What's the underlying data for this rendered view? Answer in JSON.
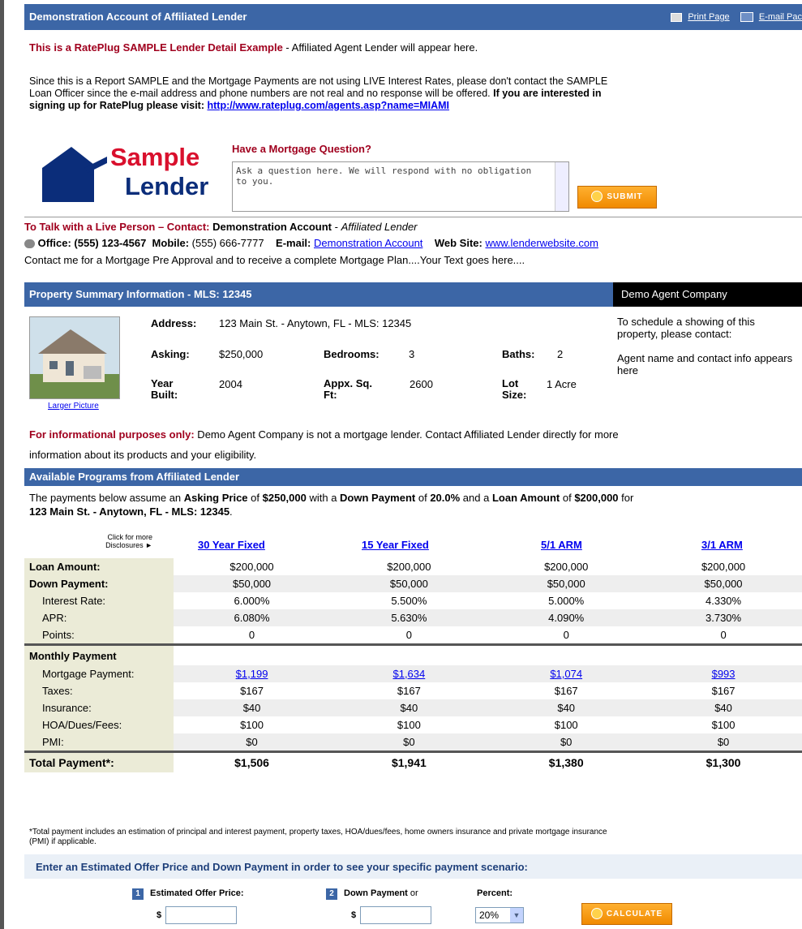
{
  "header": {
    "title": "Demonstration Account of Affiliated Lender",
    "print_label": "Print Page",
    "email_label": "E-mail Pac"
  },
  "intro": {
    "sample_bold": "This is a RatePlug SAMPLE Lender Detail Example",
    "sample_rest": " - Affiliated Agent Lender will appear here.",
    "note_line1": "Since this is a Report SAMPLE and the Mortgage Payments are not using LIVE Interest Rates, please don't contact the SAMPLE",
    "note_line2_a": "Loan Officer since the e-mail address and phone numbers are not real and no response will be offered. ",
    "note_line2_b": "If you are interested in",
    "note_line3": "signing up for RatePlug please visit: ",
    "signup_link": "http://www.rateplug.com/agents.asp?name=MIAMI"
  },
  "logo": {
    "word1": "Sample",
    "word2": "Lender"
  },
  "question": {
    "title": "Have a Mortgage Question?",
    "placeholder": "Ask a question here. We will respond with no obligation to you.",
    "submit_label": "SUBMIT"
  },
  "contact": {
    "lead": "To Talk with a Live Person – Contact:",
    "name": "Demonstration Account",
    "role": "Affiliated Lender",
    "office_label": "Office: (555) 123-4567",
    "mobile_label": "Mobile:",
    "mobile": "(555) 666-7777",
    "email_label": "E-mail:",
    "email_link": "Demonstration Account",
    "web_label": "Web Site:",
    "web_link": "www.lenderwebsite.com",
    "message": "Contact me for a Mortgage Pre Approval and to receive a complete Mortgage Plan....Your Text goes here...."
  },
  "property": {
    "bar_title": "Property Summary Information - MLS: 12345",
    "agent_company": "Demo Agent Company",
    "larger_picture": "Larger Picture",
    "address_label": "Address:",
    "address": "123 Main St. - Anytown, FL - MLS: 12345",
    "asking_label": "Asking:",
    "asking": "$250,000",
    "bedrooms_label": "Bedrooms:",
    "bedrooms": "3",
    "baths_label": "Baths:",
    "baths": "2",
    "year_label_1": "Year",
    "year_label_2": "Built:",
    "year": "2004",
    "sqft_label_1": "Appx. Sq.",
    "sqft_label_2": "Ft:",
    "sqft": "2600",
    "lot_label_1": "Lot",
    "lot_label_2": "Size:",
    "lot": "1 Acre",
    "agent_note_1": "To schedule a showing of this property, please contact:",
    "agent_note_2": "Agent name and contact info appears here"
  },
  "disclaimer": {
    "bold": "For informational purposes only:",
    "line1": " Demo Agent Company is not a mortgage lender. Contact Affiliated Lender directly for more",
    "line2": "information about its products and your eligibility."
  },
  "programs": {
    "bar_title": "Available Programs from Affiliated Lender",
    "sum_a": "The payments below assume an ",
    "sum_b": "Asking Price",
    "sum_c": " of ",
    "sum_d": "$250,000",
    "sum_e": " with a ",
    "sum_f": "Down Payment",
    "sum_g": " of ",
    "sum_h": "20.0%",
    "sum_i": " and a ",
    "sum_j": "Loan Amount",
    "sum_k": " of ",
    "sum_l": "$200,000",
    "sum_m": " for",
    "sum_line2": "123 Main St. - Anytown, FL - MLS: 12345",
    "sum_line2_end": ".",
    "click_more_1": "Click for more",
    "click_more_2": "Disclosures ►",
    "columns": [
      "30 Year Fixed",
      "15 Year Fixed",
      "5/1 ARM",
      "3/1 ARM"
    ],
    "rows": {
      "loan_amount": {
        "label": "Loan Amount:",
        "values": [
          "$200,000",
          "$200,000",
          "$200,000",
          "$200,000"
        ]
      },
      "down_payment": {
        "label": "Down Payment:",
        "values": [
          "$50,000",
          "$50,000",
          "$50,000",
          "$50,000"
        ]
      },
      "interest_rate": {
        "label": "Interest Rate:",
        "values": [
          "6.000%",
          "5.500%",
          "5.000%",
          "4.330%"
        ]
      },
      "apr": {
        "label": "APR:",
        "values": [
          "6.080%",
          "5.630%",
          "4.090%",
          "3.730%"
        ]
      },
      "points": {
        "label": "Points:",
        "values": [
          "0",
          "0",
          "0",
          "0"
        ]
      },
      "monthly_header": {
        "label": "Monthly Payment"
      },
      "mortgage_payment": {
        "label": "Mortgage Payment:",
        "values": [
          "$1,199",
          "$1,634",
          "$1,074",
          "$993"
        ]
      },
      "taxes": {
        "label": "Taxes:",
        "values": [
          "$167",
          "$167",
          "$167",
          "$167"
        ]
      },
      "insurance": {
        "label": "Insurance:",
        "values": [
          "$40",
          "$40",
          "$40",
          "$40"
        ]
      },
      "hoa": {
        "label": "HOA/Dues/Fees:",
        "values": [
          "$100",
          "$100",
          "$100",
          "$100"
        ]
      },
      "pmi": {
        "label": "PMI:",
        "values": [
          "$0",
          "$0",
          "$0",
          "$0"
        ]
      },
      "total": {
        "label": "Total Payment*:",
        "values": [
          "$1,506",
          "$1,941",
          "$1,380",
          "$1,300"
        ]
      }
    },
    "footnote_1": "*Total payment includes an estimation of principal and interest payment, property taxes, HOA/dues/fees, home owners insurance and private mortgage insurance",
    "footnote_2": "(PMI) if applicable."
  },
  "calculator": {
    "heading": "Enter an Estimated Offer Price and Down Payment in order to see your specific payment scenario:",
    "step1_num": "1",
    "step1_label": "Estimated Offer Price:",
    "step2_num": "2",
    "step2_label": "Down Payment",
    "step2_or": " or",
    "percent_label": "Percent:",
    "dollar": "$",
    "percent_value": "20%",
    "calculate_label": "CALCULATE"
  },
  "colors": {
    "bar_blue": "#3c66a6",
    "accent_red": "#a0001e",
    "button_orange": "#f5a020",
    "label_bg": "#ebebd7"
  }
}
